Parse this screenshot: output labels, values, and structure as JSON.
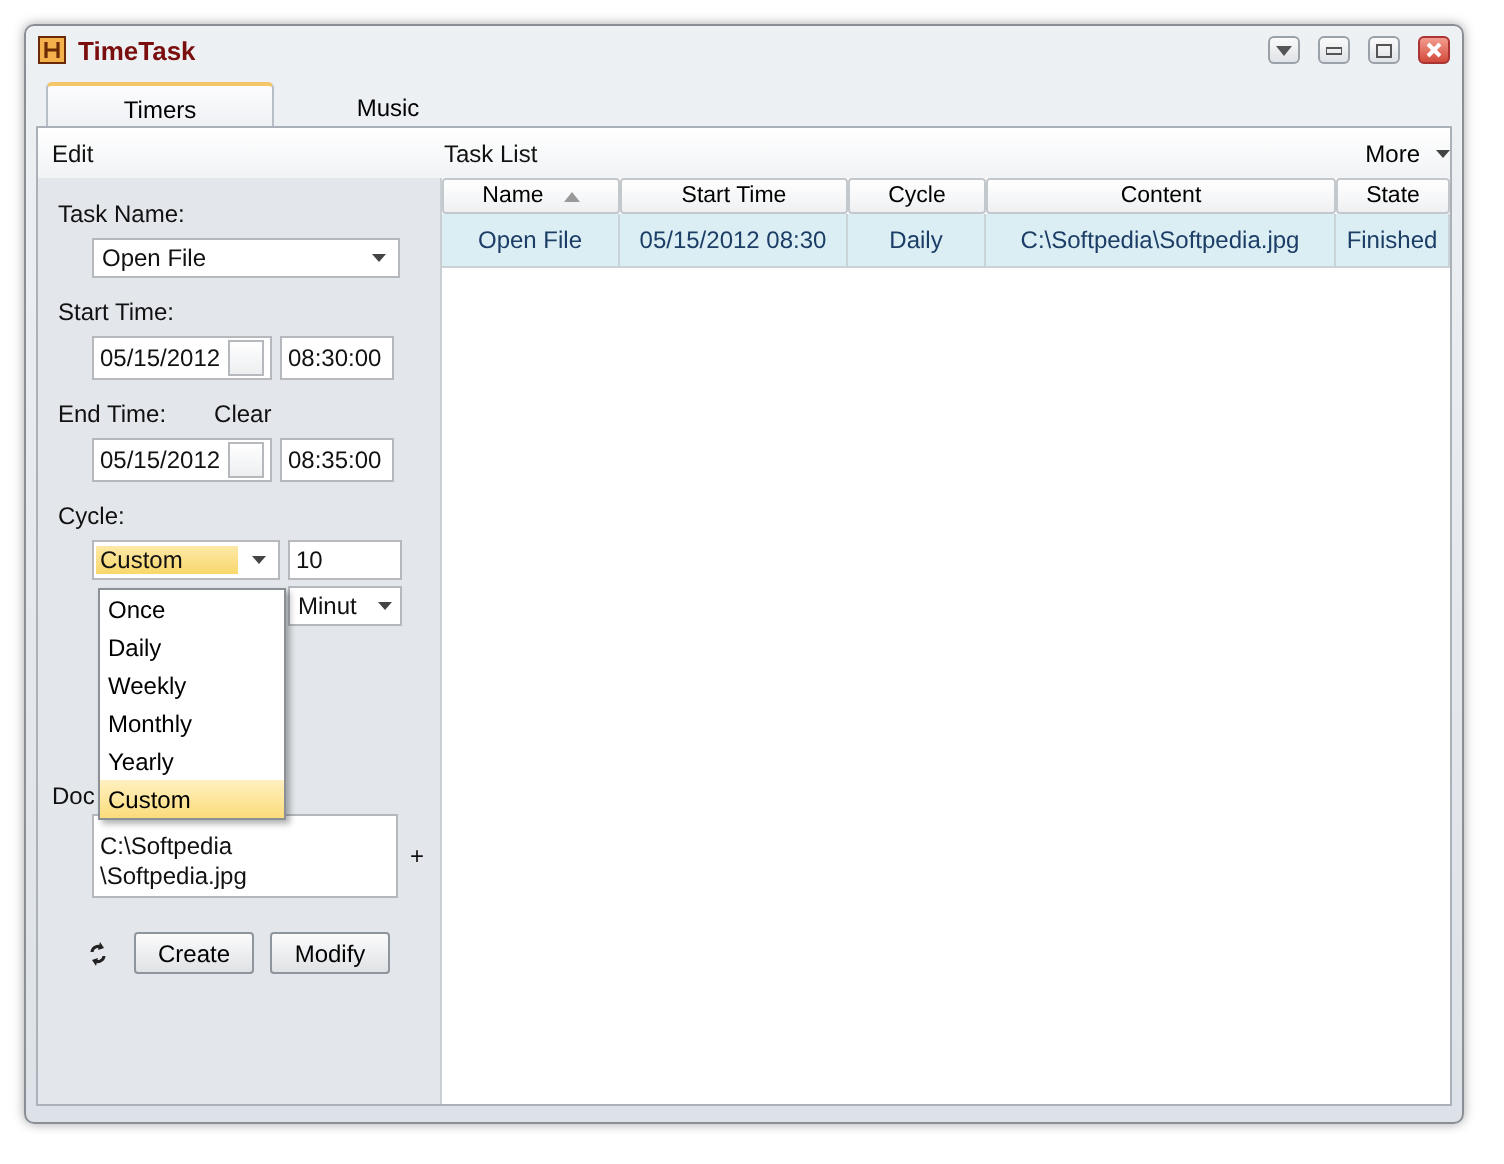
{
  "window": {
    "title": "TimeTask"
  },
  "tabs": [
    {
      "label": "Timers",
      "selected": true
    },
    {
      "label": "Music",
      "selected": false
    }
  ],
  "edit_panel": {
    "header": "Edit",
    "task_name": {
      "label": "Task Name:",
      "value": "Open File"
    },
    "start_time": {
      "label": "Start Time:",
      "date": "05/15/2012",
      "time": "08:30:00"
    },
    "end_time": {
      "label": "End Time:",
      "clear": "Clear",
      "date": "05/15/2012",
      "time": "08:35:00"
    },
    "cycle": {
      "label": "Cycle:",
      "value": "Custom",
      "interval": "10",
      "unit": "Minut",
      "options": [
        {
          "label": "Once",
          "selected": false
        },
        {
          "label": "Daily",
          "selected": false
        },
        {
          "label": "Weekly",
          "selected": false
        },
        {
          "label": "Monthly",
          "selected": false
        },
        {
          "label": "Yearly",
          "selected": false
        },
        {
          "label": "Custom",
          "selected": true
        }
      ]
    },
    "document": {
      "label": "Doc",
      "value": "C:\\Softpedia\n\\Softpedia.jpg",
      "add": "+"
    },
    "buttons": [
      "Create",
      "Modify"
    ]
  },
  "task_list": {
    "header": "Task List",
    "more": "More",
    "columns": [
      {
        "label": "Name",
        "sorted": true
      },
      {
        "label": "Start Time",
        "sorted": false
      },
      {
        "label": "Cycle",
        "sorted": false
      },
      {
        "label": "Content",
        "sorted": false
      },
      {
        "label": "State",
        "sorted": false
      }
    ],
    "rows": [
      {
        "selected": true,
        "cells": [
          "Open File",
          "05/15/2012 08:30",
          "Daily",
          "C:\\Softpedia\\Softpedia.jpg",
          "Finished"
        ]
      }
    ]
  }
}
